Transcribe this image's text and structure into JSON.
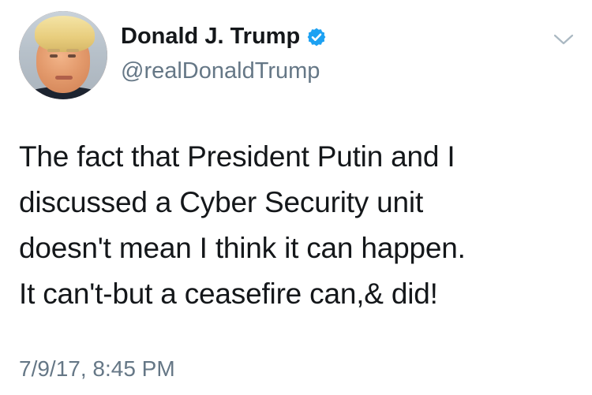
{
  "tweet": {
    "author": {
      "name": "Donald J. Trump",
      "handle": "@realDonaldTrump",
      "verified": true,
      "verified_icon": "verified-badge-icon",
      "verified_color": "#1da1f2"
    },
    "text": "The fact that President Putin and I\ndiscussed a Cyber Security unit\ndoesn't mean I think it can happen.\nIt can't-but a ceasefire can,& did!",
    "timestamp": "7/9/17, 8:45 PM",
    "menu_icon": "chevron-down-icon"
  }
}
